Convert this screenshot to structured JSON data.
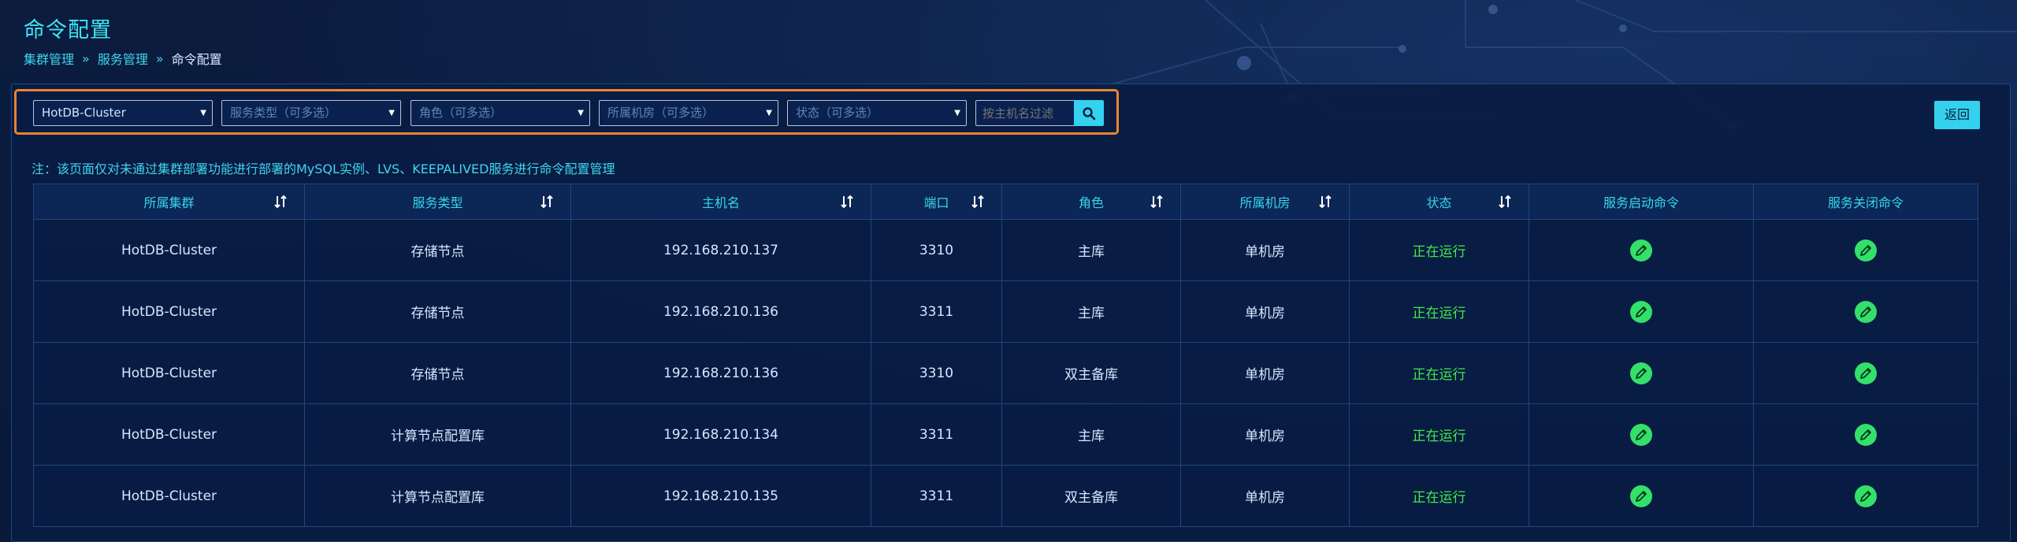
{
  "page": {
    "title": "命令配置",
    "breadcrumb": [
      "集群管理",
      "服务管理",
      "命令配置"
    ],
    "breadcrumb_sep": "»"
  },
  "filters": {
    "cluster": "HotDB-Cluster",
    "service_type": "服务类型（可多选）",
    "role": "角色（可多选）",
    "room": "所属机房（可多选）",
    "status": "状态（可多选）",
    "host_placeholder": "按主机名过滤"
  },
  "back_label": "返回",
  "note": "注：该页面仅对未通过集群部署功能进行部署的MySQL实例、LVS、KEEPALIVED服务进行命令配置管理",
  "columns": [
    "所属集群",
    "服务类型",
    "主机名",
    "端口",
    "角色",
    "所属机房",
    "状态",
    "服务启动命令",
    "服务关闭命令"
  ],
  "rows": [
    {
      "cluster": "HotDB-Cluster",
      "type": "存储节点",
      "host": "192.168.210.137",
      "port": "3310",
      "role": "主库",
      "room": "单机房",
      "status": "正在运行"
    },
    {
      "cluster": "HotDB-Cluster",
      "type": "存储节点",
      "host": "192.168.210.136",
      "port": "3311",
      "role": "主库",
      "room": "单机房",
      "status": "正在运行"
    },
    {
      "cluster": "HotDB-Cluster",
      "type": "存储节点",
      "host": "192.168.210.136",
      "port": "3310",
      "role": "双主备库",
      "room": "单机房",
      "status": "正在运行"
    },
    {
      "cluster": "HotDB-Cluster",
      "type": "计算节点配置库",
      "host": "192.168.210.134",
      "port": "3311",
      "role": "主库",
      "room": "单机房",
      "status": "正在运行"
    },
    {
      "cluster": "HotDB-Cluster",
      "type": "计算节点配置库",
      "host": "192.168.210.135",
      "port": "3311",
      "role": "双主备库",
      "room": "单机房",
      "status": "正在运行"
    }
  ],
  "icons": {
    "sort": "sort-icon",
    "search": "search-icon",
    "edit": "edit-icon",
    "caret": "caret-down-icon"
  },
  "colors": {
    "accent": "#34d2ee",
    "highlight_border": "#e8852f",
    "running": "#42e84a",
    "edit_button": "#33e06a"
  }
}
